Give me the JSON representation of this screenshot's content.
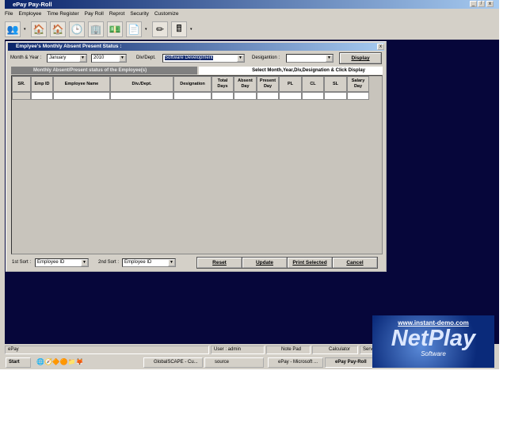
{
  "app": {
    "title": "ePay Pay-Roll",
    "window_buttons": [
      "_",
      "̸",
      "x"
    ]
  },
  "menu": [
    "File",
    "Employee",
    "Time Register",
    "Pay Roll",
    "Reprot",
    "Security",
    "Customize"
  ],
  "dialog": {
    "title": "Emplyee's Monthly Absent Present Status :",
    "close": "x",
    "month_year_label": "Month & Year :",
    "month": "January",
    "year": "2010",
    "div_label": "Div/Dept.",
    "div": "Software Development",
    "desig_label": "Desigantion :",
    "desig": "",
    "display_button": "Display",
    "section_title": "Monthly Absent/Present status of the Employee(s)",
    "hint": "Select Month,Year,Div,Designation & Click Display",
    "columns": [
      "SR.",
      "Emp ID",
      "Employee Name",
      "Div./Dept.",
      "Designation",
      "Total Days",
      "Absent Day",
      "Present Day",
      "PL",
      "CL",
      "SL",
      "Salary Day"
    ],
    "sort1_label": "1st Sort :",
    "sort1": "Employee ID",
    "sort2_label": "2nd Sort :",
    "sort2": "Employee ID",
    "buttons": {
      "reset": "Reset",
      "update": "Update",
      "print": "Print Selected",
      "cancel": "Cancel"
    }
  },
  "status": {
    "app": "ePay",
    "user": "User : admin",
    "notepad": "Note Pad",
    "calculator": "Calculator",
    "server": "Serv"
  },
  "taskbar": {
    "start": "Start",
    "tasks": [
      "GlobalSCAPE - Cu...",
      "source",
      "ePay - Microsoft ...",
      "ePay Pay-Roll"
    ]
  },
  "logo": {
    "url": "www.instant-demo.com",
    "name": "NetPlay",
    "sub": "Software"
  }
}
